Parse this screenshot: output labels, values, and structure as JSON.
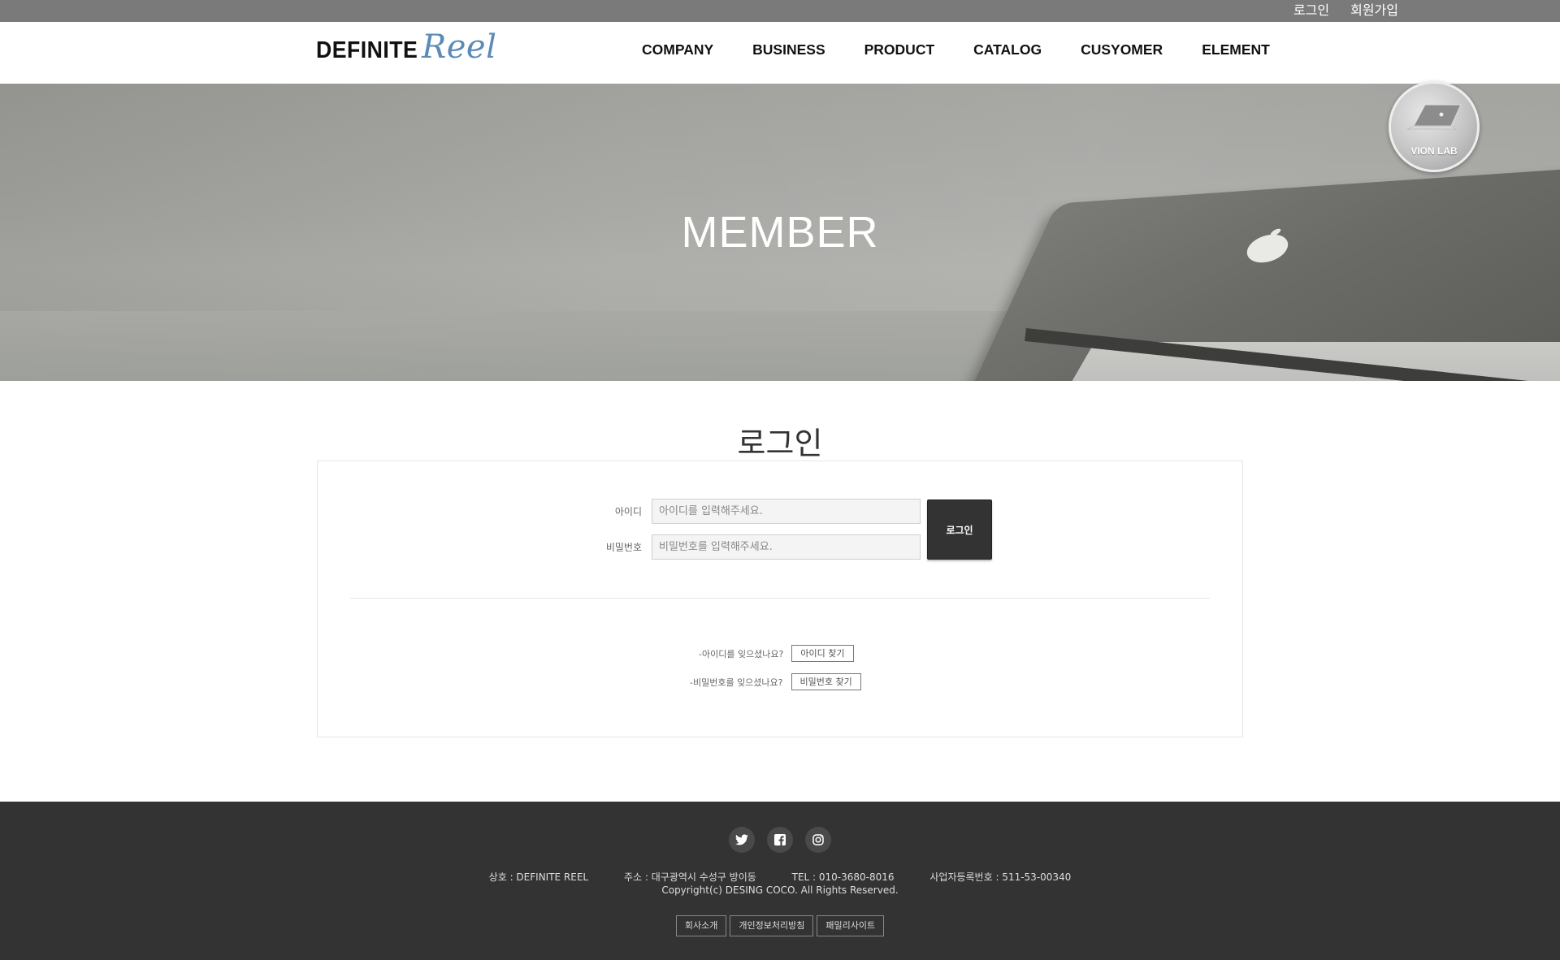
{
  "topbar": {
    "login": "로그인",
    "signup": "회원가입"
  },
  "logo": {
    "bold": "DEFINITE",
    "script": "Reel"
  },
  "nav": [
    "COMPANY",
    "BUSINESS",
    "PRODUCT",
    "CATALOG",
    "CUSYOMER",
    "ELEMENT"
  ],
  "hero": {
    "title": "MEMBER",
    "badge": "VION LAB"
  },
  "login": {
    "title": "로그인",
    "id_label": "아이디",
    "id_placeholder": "아이디를 입력해주세요.",
    "pw_label": "비밀번호",
    "pw_placeholder": "비밀번호를 입력해주세요.",
    "submit": "로그인",
    "forgot_id": "-아이디를 잊으셨나요?",
    "find_id": "아이디 찾기",
    "forgot_pw": "-비밀번호를 잊으셨나요?",
    "find_pw": "비밀번호 찾기"
  },
  "footer": {
    "social": [
      "twitter-icon",
      "facebook-icon",
      "instagram-icon"
    ],
    "company": "상호 : DEFINITE REEL",
    "address": "주소 : 대구광역시 수성구 방이동",
    "tel": "TEL : 010-3680-8016",
    "biz_no": "사업자등록번호 : 511-53-00340",
    "copyright": "Copyright(c) DESING COCO. All Rights Reserved.",
    "links": [
      "회사소개",
      "개인정보처리방침",
      "패밀리사이트"
    ]
  },
  "colors": {
    "topbar": "#7a7a7a",
    "footer": "#333333",
    "logo_script": "#5b8bb6",
    "button": "#333333"
  }
}
